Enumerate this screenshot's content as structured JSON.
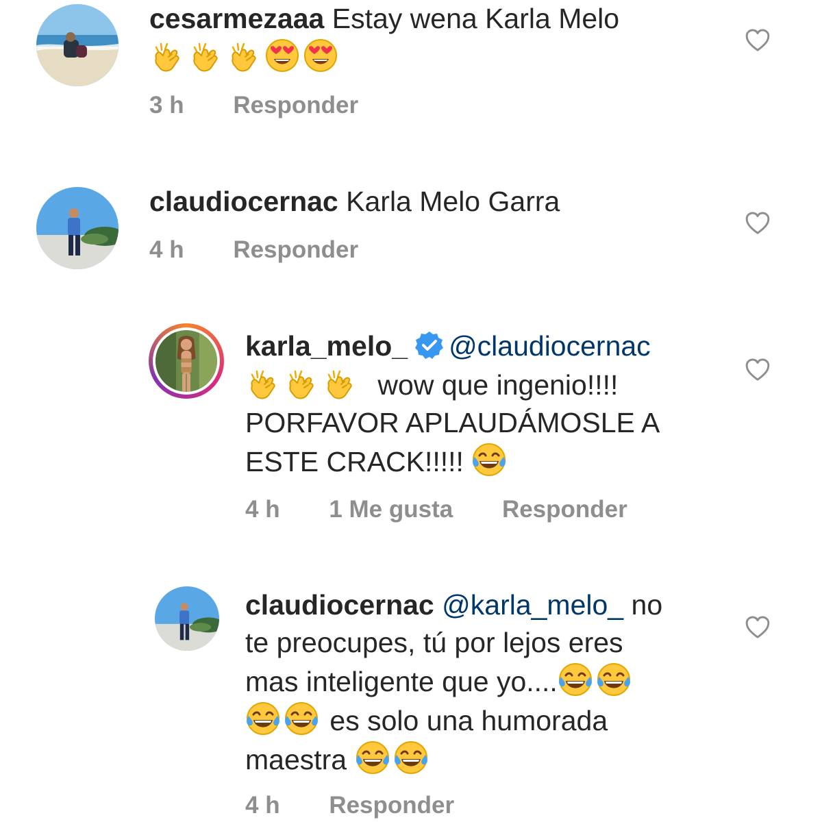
{
  "comments": [
    {
      "username": "cesarmezaaa",
      "text": "Estay wena Karla Melo",
      "emojis": [
        "clapping-hands",
        "clapping-hands",
        "clapping-hands",
        "heart-eyes",
        "heart-eyes"
      ],
      "time": "3 h",
      "reply_label": "Responder"
    },
    {
      "username": "claudiocernac",
      "text": "Karla Melo Garra",
      "time": "4 h",
      "reply_label": "Responder"
    },
    {
      "username": "karla_melo_",
      "verified": true,
      "mention": "@claudiocernac",
      "text_1": "wow que ingenio!!!!",
      "text_2": "PORFAVOR APLAUDÁMOSLE A",
      "text_3": "ESTE CRACK!!!!!",
      "time": "4 h",
      "likes": "1 Me gusta",
      "reply_label": "Responder"
    },
    {
      "username": "claudiocernac",
      "mention": "@karla_melo_",
      "text_1": "no",
      "text_2": "te preocupes, tú por lejos eres",
      "text_3": "mas inteligente que yo....",
      "text_4": "es solo una humorada",
      "text_5": "maestra",
      "time": "4 h",
      "reply_label": "Responder"
    }
  ],
  "colors": {
    "text": "#262626",
    "meta": "#8e8e8e",
    "mention": "#00376b",
    "verified": "#3897f0",
    "emoji": "#ffc83d"
  },
  "icons": [
    "heart-outline-icon",
    "verified-badge-icon",
    "clapping-hands-emoji",
    "heart-eyes-emoji",
    "tears-of-joy-emoji"
  ]
}
